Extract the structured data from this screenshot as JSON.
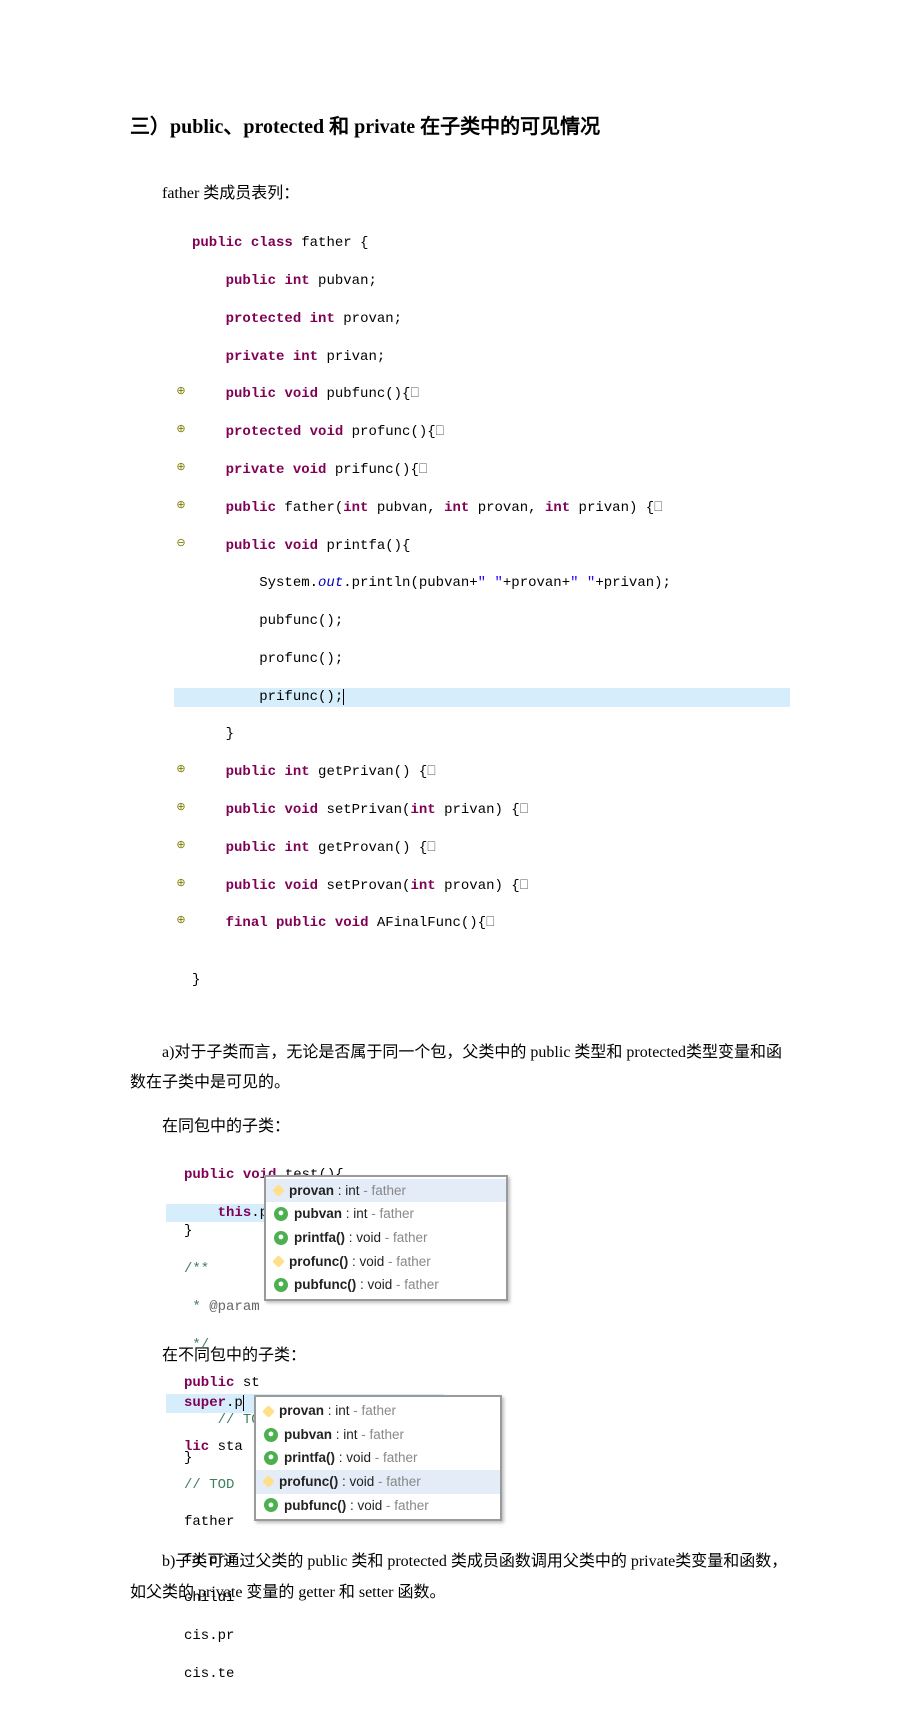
{
  "title": "三）public、protected 和 private 在子类中的可见情况",
  "father_intro": "father 类成员表列：",
  "father_code": {
    "l1": "public class father {",
    "l2": "    public int pubvan;",
    "l3": "    protected int provan;",
    "l4": "    private int privan;",
    "l5": "    public void pubfunc(){",
    "l6": "    protected void profunc(){",
    "l7": "    private void prifunc(){",
    "l8": "    public father(int pubvan, int provan, int privan) {",
    "l9": "    public void printfa(){",
    "l10": "        System.out.println(pubvan+\" \"+provan+\" \"+privan);",
    "l11": "        pubfunc();",
    "l12": "        profunc();",
    "l13": "        prifunc();",
    "l14": "    }",
    "l15": "    public int getPrivan() {",
    "l16": "    public void setPrivan(int privan) {",
    "l17": "    public int getProvan() {",
    "l18": "    public void setProvan(int provan) {",
    "l19": "    final public void AFinalFunc(){",
    "l20": "",
    "l21": "}"
  },
  "para_a": "a)对于子类而言，无论是否属于同一个包，父类中的 public 类型和 protected类型变量和函数在子类中是可见的。",
  "caption_same": "在同包中的子类：",
  "samepkg": {
    "s1": "public void test(){",
    "s2": "    this.p",
    "s3": "}",
    "s4": "/**",
    "s5": " * @param",
    "s6": " */",
    "s7": "public st",
    "s8": "    // TO",
    "s9": "}"
  },
  "ac1": {
    "r1": {
      "name": "provan",
      "sig": " : int",
      "src": " - father"
    },
    "r2": {
      "name": "pubvan",
      "sig": " : int",
      "src": " - father"
    },
    "r3": {
      "name": "printfa()",
      "sig": " : void",
      "src": " - father"
    },
    "r4": {
      "name": "profunc()",
      "sig": " : void",
      "src": " - father"
    },
    "r5": {
      "name": "pubfunc()",
      "sig": " : void",
      "src": " - father"
    }
  },
  "caption_diff": "在不同包中的子类：",
  "diffpkg": {
    "d1": "super.p",
    "d2": "lic sta",
    "d3": "// TOD",
    "d4": "father",
    "d5": "fa.pri",
    "d6": "childi",
    "d7": "cis.pr",
    "d8": "cis.te"
  },
  "ac2": {
    "r1": {
      "name": "provan",
      "sig": " : int",
      "src": " - father"
    },
    "r2": {
      "name": "pubvan",
      "sig": " : int",
      "src": " - father"
    },
    "r3": {
      "name": "printfa()",
      "sig": " : void",
      "src": " - father"
    },
    "r4": {
      "name": "profunc()",
      "sig": " : void",
      "src": " - father"
    },
    "r5": {
      "name": "pubfunc()",
      "sig": " : void",
      "src": " - father"
    }
  },
  "para_b": "b)子类可通过父类的 public 类和 protected 类成员函数调用父类中的 private类变量和函数，如父类的 private 变量的 getter 和 setter 函数。"
}
